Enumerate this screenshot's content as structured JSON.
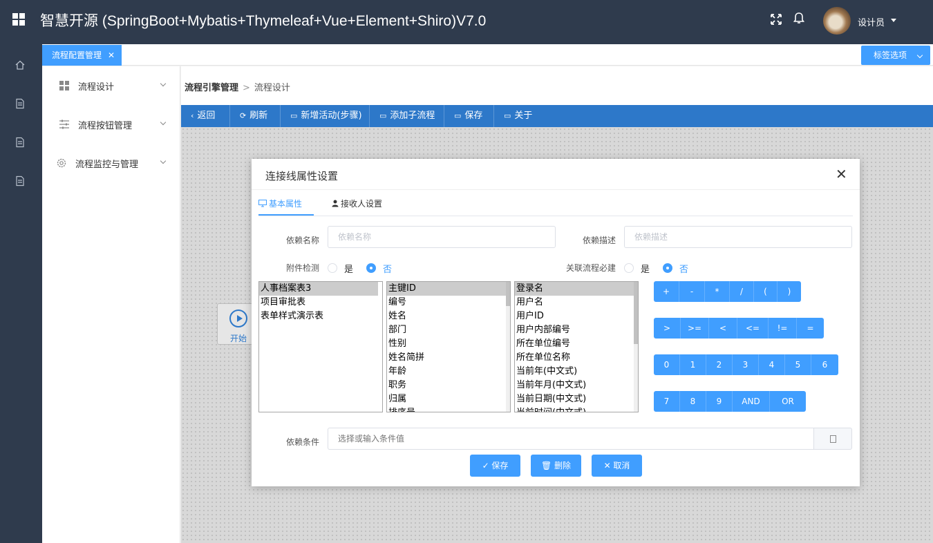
{
  "header": {
    "title": "智慧开源 (SpringBoot+Mybatis+Thymeleaf+Vue+Element+Shiro)V7.0",
    "user_name": "设计员"
  },
  "tabs": {
    "active_label": "流程配置管理",
    "close_glyph": "✕",
    "options_label": "标签选项"
  },
  "submenu": {
    "items": [
      {
        "label": "流程设计",
        "icon": "grid-icon"
      },
      {
        "label": "流程按钮管理",
        "icon": "sliders-icon"
      },
      {
        "label": "流程监控与管理",
        "icon": "gear-icon"
      }
    ]
  },
  "breadcrumb": {
    "root": "流程引擎管理",
    "separator": ">",
    "current": "流程设计"
  },
  "toolbar": {
    "items": [
      {
        "label": "返回",
        "icon": "chevron-left-icon",
        "glyph": "‹"
      },
      {
        "label": "刷新",
        "icon": "refresh-icon",
        "glyph": "⟳"
      },
      {
        "label": "新增活动(步骤)",
        "icon": "folder-icon",
        "glyph": "▭"
      },
      {
        "label": "添加子流程",
        "icon": "folder-icon",
        "glyph": "▭"
      },
      {
        "label": "保存",
        "icon": "save-icon",
        "glyph": "▭"
      },
      {
        "label": "关于",
        "icon": "monitor-icon",
        "glyph": "▭"
      }
    ]
  },
  "canvas": {
    "start_node_label": "开始"
  },
  "modal": {
    "title": "连接线属性设置",
    "close_glyph": "✕",
    "tabs": [
      {
        "label": "基本属性",
        "icon": "monitor-icon",
        "active": true
      },
      {
        "label": "接收人设置",
        "icon": "user-icon",
        "active": false
      }
    ],
    "fields": {
      "dep_name_label": "依赖名称",
      "dep_name_placeholder": "依赖名称",
      "dep_desc_label": "依赖描述",
      "dep_desc_placeholder": "依赖描述",
      "attach_check_label": "附件检测",
      "related_flow_label": "关联流程必建",
      "yes": "是",
      "no": "否",
      "attach_check_value": "否",
      "related_flow_value": "否",
      "condition_label": "依赖条件",
      "condition_placeholder": "选择或输入条件值"
    },
    "list_tables": {
      "items": [
        "人事档案表3",
        "项目审批表",
        "表单样式演示表"
      ],
      "selected": "人事档案表3"
    },
    "list_fields": {
      "items": [
        "主键ID",
        "编号",
        "姓名",
        "部门",
        "性别",
        "姓名简拼",
        "年龄",
        "职务",
        "归属",
        "排序号"
      ],
      "selected": "主键ID"
    },
    "list_system": {
      "items": [
        "登录名",
        "用户名",
        "用户ID",
        "用户内部编号",
        "所在单位编号",
        "所在单位名称",
        "当前年(中文式)",
        "当前年月(中文式)",
        "当前日期(中文式)",
        "当前时间(中文式)"
      ],
      "selected": "登录名"
    },
    "keypad": {
      "row1": [
        "+",
        "-",
        "*",
        "/",
        "(",
        ")"
      ],
      "row2": [
        ">",
        ">=",
        "<",
        "<=",
        "!=",
        "="
      ],
      "row3": [
        "0",
        "1",
        "2",
        "3",
        "4",
        "5",
        "6"
      ],
      "row4": [
        "7",
        "8",
        "9",
        "AND",
        "OR"
      ]
    },
    "footer": {
      "save": "✓ 保存",
      "delete": "🗑 删除",
      "cancel": "✕ 取消"
    }
  },
  "colors": {
    "primary": "#409eff",
    "header_bg": "#2f3b4d",
    "toolbar_bg": "#2d78c9"
  }
}
